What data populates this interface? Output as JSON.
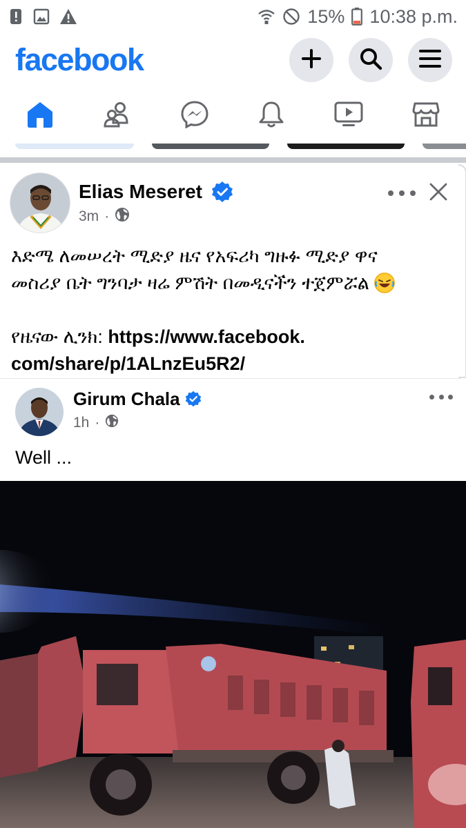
{
  "status_bar": {
    "battery": "15%",
    "time": "10:38 p.m.",
    "left_icons": [
      "alert-icon",
      "image-icon",
      "warning-icon"
    ],
    "right_icons": [
      "wifi-icon",
      "do-not-disturb-icon",
      "battery-icon"
    ]
  },
  "header": {
    "logo": "facebook",
    "actions": [
      "create-icon",
      "search-icon",
      "menu-icon"
    ]
  },
  "nav": {
    "tabs": [
      "home",
      "friends",
      "messenger",
      "notifications",
      "video",
      "marketplace"
    ],
    "active": "home"
  },
  "post": {
    "author": "Elias Meseret",
    "time": "3m",
    "separator": "·",
    "audience": "public",
    "text_line1": "እድሜ ለመሠረት ሚድያ ዜና የአፍሪካ ግዙፉ ሚድያ ዋና",
    "text_line2": "መስሪያ ቤት ግንባታ ዛሬ ምሽት በመዲናችን ተጀምሯል",
    "emoji": "rolling-on-floor-laughing",
    "link_label": "የዜናው ሊንክ:",
    "link_part1": "https://www.facebook.",
    "link_part2": "com/share/p/1ALnzEu5R2/"
  },
  "shared_post": {
    "author": "Girum Chala",
    "time": "1h",
    "separator": "·",
    "text": "Well ..."
  },
  "colors": {
    "brand": "#1877f2",
    "secondary_text": "#65676b",
    "button_bg": "#e4e6eb"
  }
}
